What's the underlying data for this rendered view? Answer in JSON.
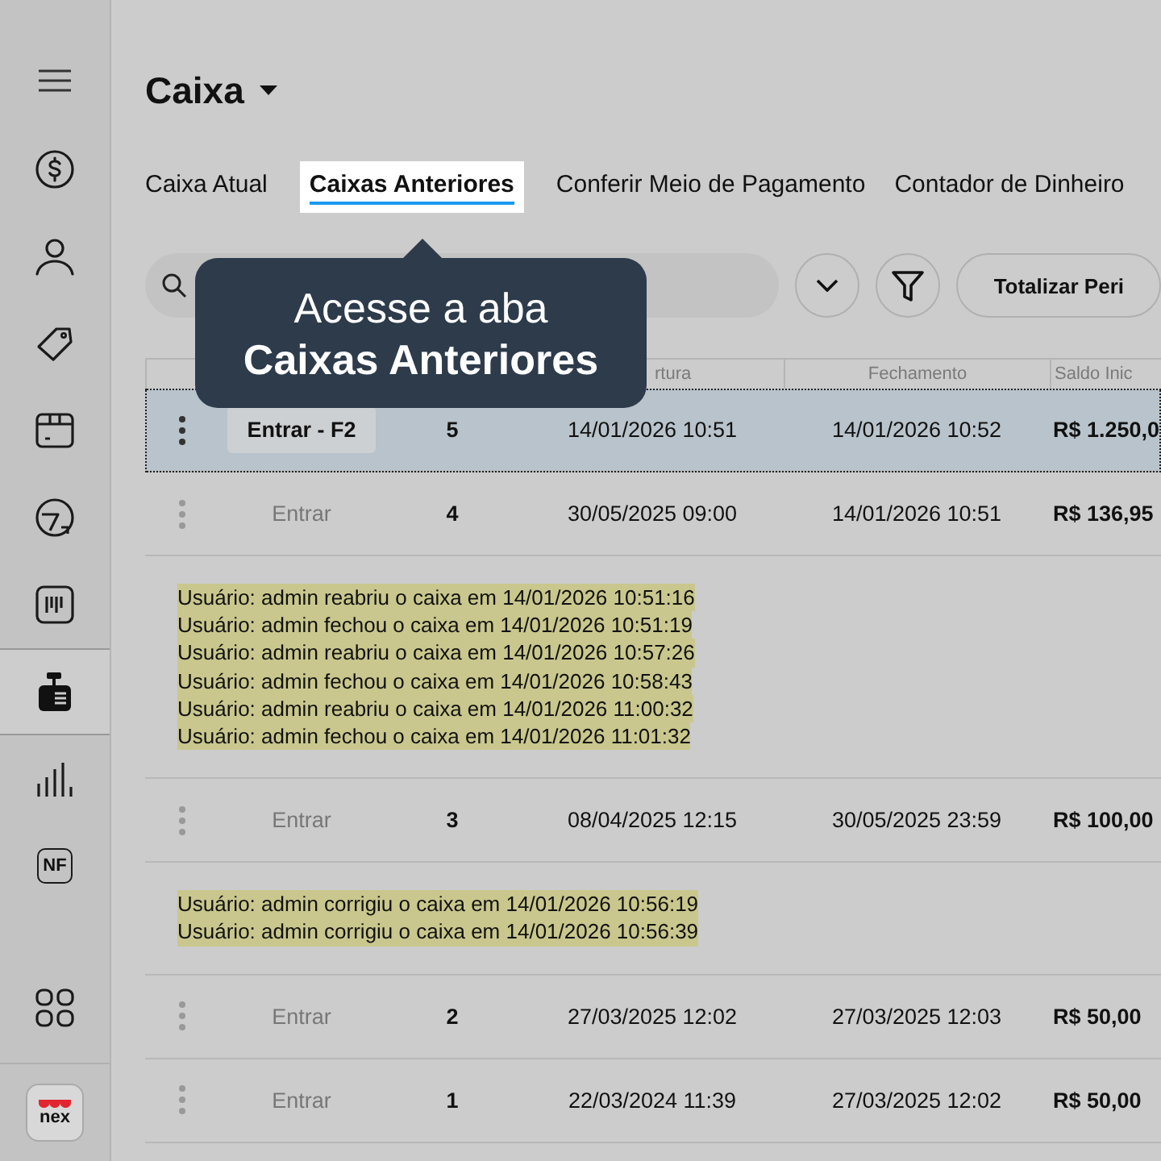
{
  "sidebar": {
    "items": [
      {
        "selected": false
      },
      {
        "selected": false
      },
      {
        "selected": false
      },
      {
        "selected": false
      },
      {
        "selected": false
      },
      {
        "selected": false
      },
      {
        "selected": true
      },
      {
        "selected": false
      },
      {
        "label": "NF",
        "selected": false
      }
    ],
    "logo": "nex"
  },
  "title": "Caixa",
  "tabs": [
    {
      "label": "Caixa Atual",
      "selected": false
    },
    {
      "label": "Caixas Anteriores",
      "selected": true
    },
    {
      "label": "Conferir Meio de Pagamento",
      "selected": false
    },
    {
      "label": "Contador de Dinheiro",
      "selected": false
    }
  ],
  "tooltip": {
    "line1": "Acesse a aba",
    "line2": "Caixas Anteriores"
  },
  "toolbar": {
    "total_button": "Totalizar Peri"
  },
  "table": {
    "columns": [
      "rtura",
      "Fechamento",
      "Saldo Inic"
    ],
    "rows": [
      {
        "kind": "record",
        "selected": true,
        "action": "Entrar - F2",
        "number": "5",
        "opened": "14/01/2026 10:51",
        "closed": "14/01/2026 10:52",
        "balance": "R$ 1.250,0"
      },
      {
        "kind": "record",
        "selected": false,
        "action": "Entrar",
        "number": "4",
        "opened": "30/05/2025 09:00",
        "closed": "14/01/2026 10:51",
        "balance": "R$ 136,95"
      },
      {
        "kind": "log",
        "lines": [
          "Usuário: admin reabriu o caixa em 14/01/2026 10:51:16",
          "Usuário: admin fechou o caixa em 14/01/2026 10:51:19",
          "Usuário: admin reabriu o caixa em 14/01/2026 10:57:26",
          "Usuário: admin fechou o caixa em 14/01/2026 10:58:43",
          "Usuário: admin reabriu o caixa em 14/01/2026 11:00:32",
          "Usuário: admin fechou o caixa em 14/01/2026 11:01:32"
        ]
      },
      {
        "kind": "record",
        "selected": false,
        "action": "Entrar",
        "number": "3",
        "opened": "08/04/2025 12:15",
        "closed": "30/05/2025 23:59",
        "balance": "R$ 100,00"
      },
      {
        "kind": "log",
        "lines": [
          "Usuário: admin corrigiu o caixa em 14/01/2026 10:56:19",
          "Usuário: admin corrigiu o caixa em 14/01/2026 10:56:39"
        ]
      },
      {
        "kind": "record",
        "selected": false,
        "action": "Entrar",
        "number": "2",
        "opened": "27/03/2025 12:02",
        "closed": "27/03/2025 12:03",
        "balance": "R$ 50,00"
      },
      {
        "kind": "record",
        "selected": false,
        "action": "Entrar",
        "number": "1",
        "opened": "22/03/2024 11:39",
        "closed": "27/03/2025 12:02",
        "balance": "R$ 50,00"
      }
    ]
  }
}
